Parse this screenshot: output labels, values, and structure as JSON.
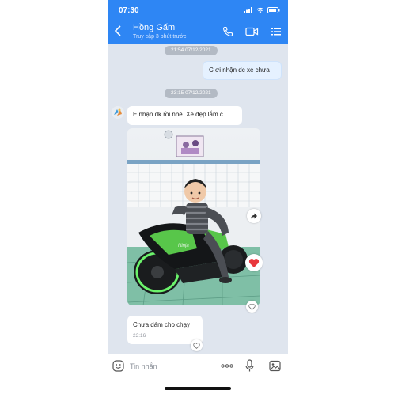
{
  "status": {
    "time": "07:30"
  },
  "header": {
    "name": "Hồng Gấm",
    "last_seen": "Truy cập 3 phút trước"
  },
  "messages": {
    "chip1": "21:54 07/12/2021",
    "out1": "C ơi nhận dc xe chưa",
    "chip2": "23:15 07/12/2021",
    "in1": "E nhận dk rồi nhé. Xe đẹp lắm c",
    "in2": "Chưa dám cho chạy",
    "in2_time": "23:16"
  },
  "input": {
    "placeholder": "Tin nhắn"
  },
  "colors": {
    "header_blue": "#2e86f4",
    "chat_bg": "#dfe5ee",
    "reaction_red": "#e8383d"
  },
  "icons": [
    "back-arrow-icon",
    "phone-icon",
    "video-icon",
    "menu-icon",
    "share-icon",
    "heart-icon",
    "emoji-icon",
    "more-icon",
    "mic-icon",
    "image-icon"
  ]
}
